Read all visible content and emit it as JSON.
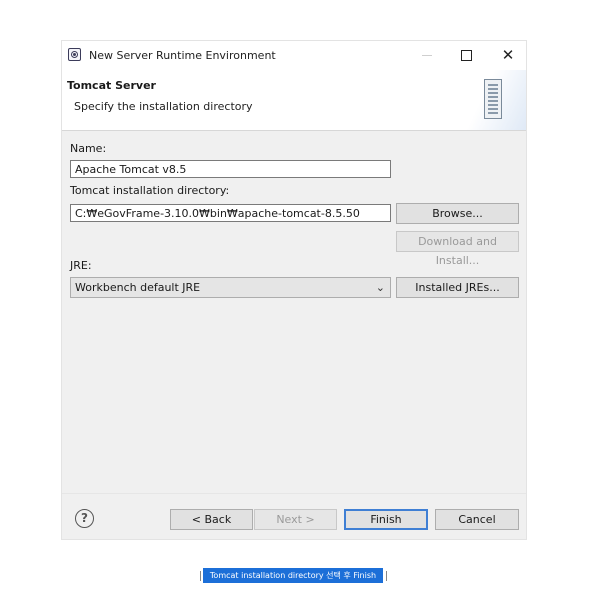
{
  "window": {
    "title": "New Server Runtime Environment",
    "close_glyph": "✕"
  },
  "header": {
    "title": "Tomcat Server",
    "subtitle": "Specify the installation directory"
  },
  "form": {
    "name_label": "Name:",
    "name_value": "Apache Tomcat v8.5",
    "dir_label": "Tomcat installation directory:",
    "dir_value": "C:₩eGovFrame-3.10.0₩bin₩apache-tomcat-8.5.50",
    "browse_label": "Browse...",
    "download_label": "Download and Install...",
    "jre_label": "JRE:",
    "jre_value": "Workbench default JRE",
    "jre_chevron": "⌄",
    "installed_jres_label": "Installed JREs..."
  },
  "footer": {
    "help_glyph": "?",
    "back_label": "< Back",
    "next_label": "Next >",
    "finish_label": "Finish",
    "cancel_label": "Cancel"
  },
  "caption": {
    "text": "Tomcat installation directory 선택 후 Finish"
  }
}
